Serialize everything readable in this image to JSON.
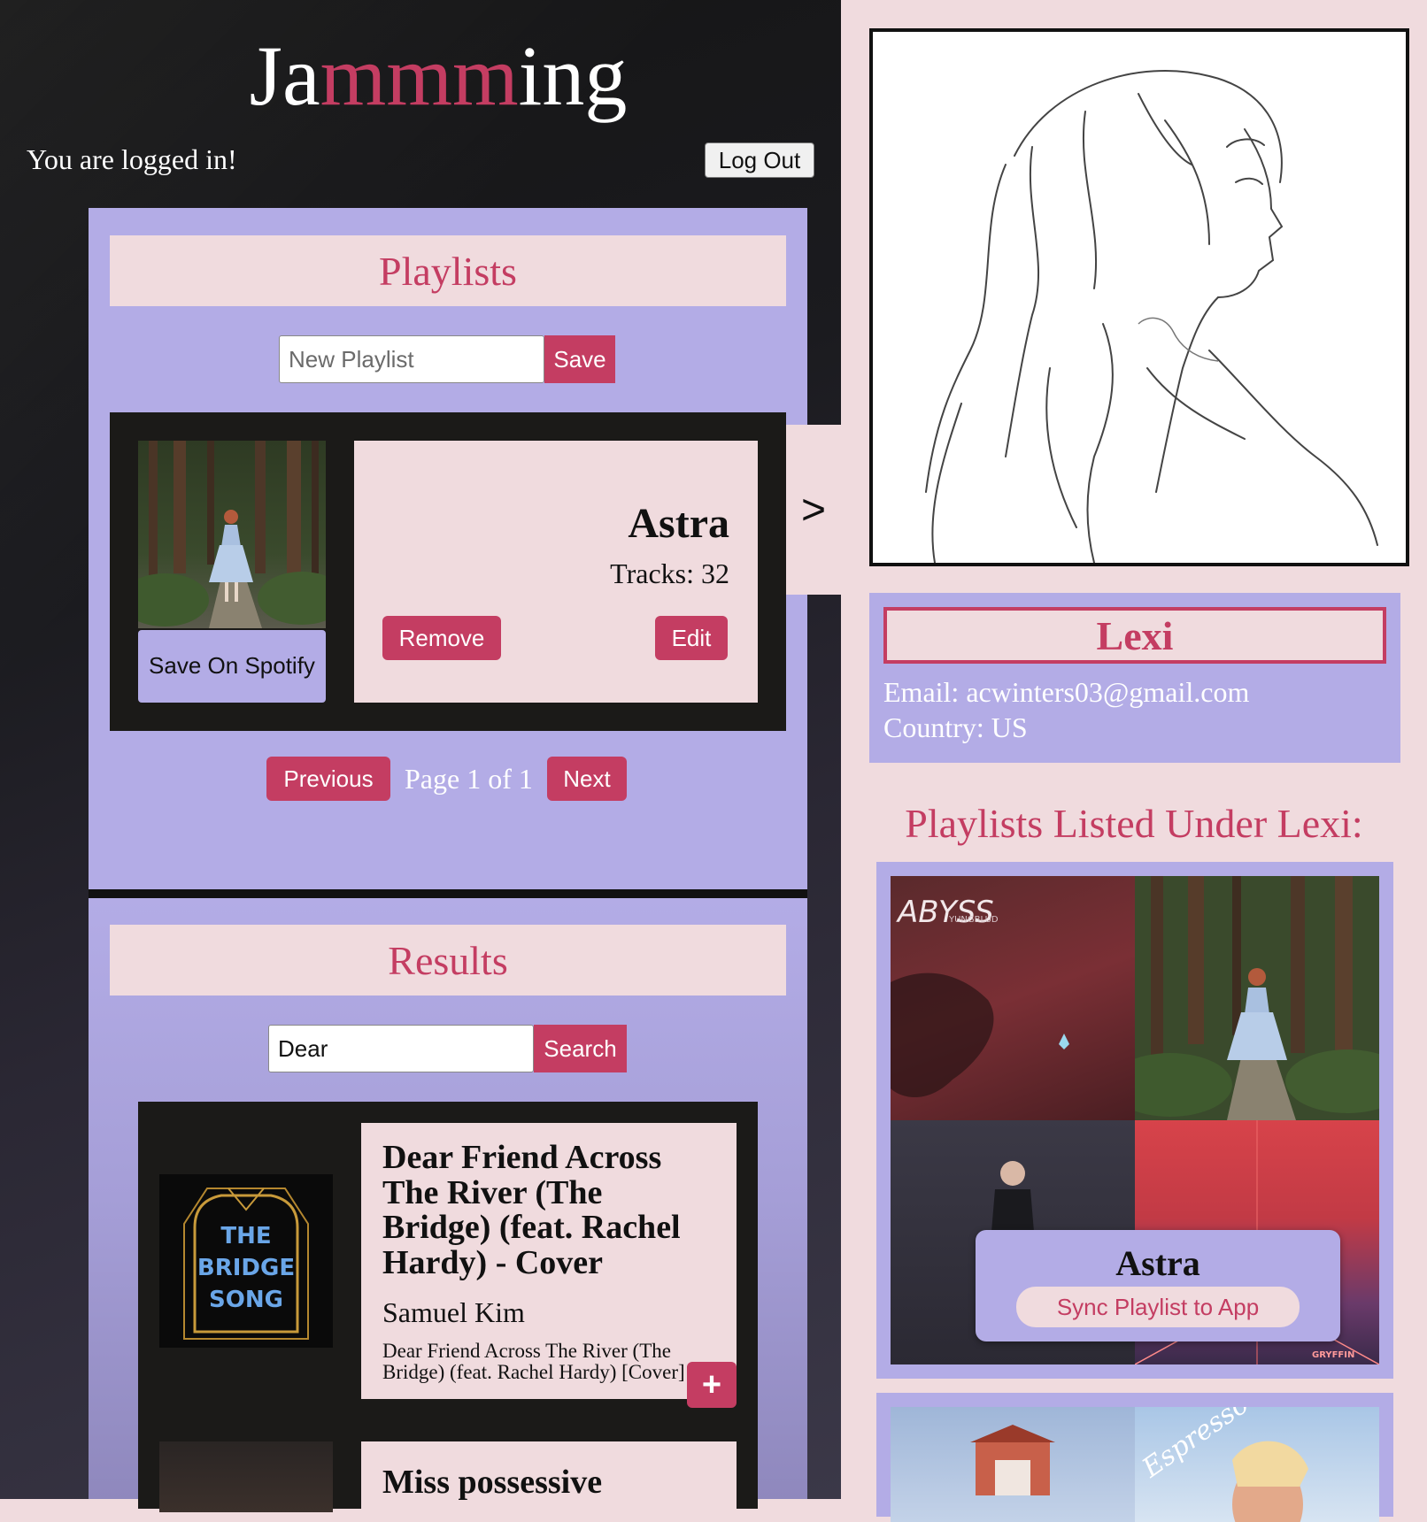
{
  "header": {
    "title_parts": [
      "Ja",
      "mmm",
      "ing"
    ],
    "status_text": "You are logged in!",
    "logout_label": "Log Out"
  },
  "playlists": {
    "heading": "Playlists",
    "new_playlist_placeholder": "New Playlist",
    "save_label": "Save",
    "current": {
      "name": "Astra",
      "tracks_text": "Tracks: 32",
      "save_on_spotify_label": "Save On Spotify",
      "remove_label": "Remove",
      "edit_label": "Edit"
    },
    "arrow_label": ">",
    "pagination": {
      "previous_label": "Previous",
      "page_text": "Page 1 of 1",
      "next_label": "Next"
    }
  },
  "results": {
    "heading": "Results",
    "search_value": "Dear",
    "search_label": "Search",
    "tracks": [
      {
        "title": "Dear Friend Across The River (The Bridge) (feat. Rachel Hardy) - Cover",
        "artist": "Samuel Kim",
        "album": "Dear Friend Across The River (The Bridge) (feat. Rachel Hardy) [Cover]",
        "cover_text": [
          "THE",
          "BRIDGE",
          "SONG"
        ],
        "add_label": "+"
      },
      {
        "title": "Miss possessive"
      }
    ]
  },
  "profile": {
    "name": "Lexi",
    "email_text": "Email: acwinters03@gmail.com",
    "country_text": "Country: US",
    "listed_heading": "Playlists Listed Under Lexi:",
    "playlist_cards": [
      {
        "name": "Astra",
        "sync_label": "Sync Playlist to App",
        "covers": [
          {
            "text": "ABYSS",
            "subtext": "YUNGBLUD"
          },
          {
            "text": ""
          },
          {
            "text": ""
          },
          {
            "text": "GRYFFIN"
          }
        ]
      },
      {
        "covers": [
          {
            "text": ""
          },
          {
            "text": "Espresso"
          }
        ]
      }
    ]
  },
  "colors": {
    "accent": "#c43d62",
    "lavender": "#b3ace6",
    "pink": "#f0dbde",
    "dark": "#1b1a18"
  }
}
